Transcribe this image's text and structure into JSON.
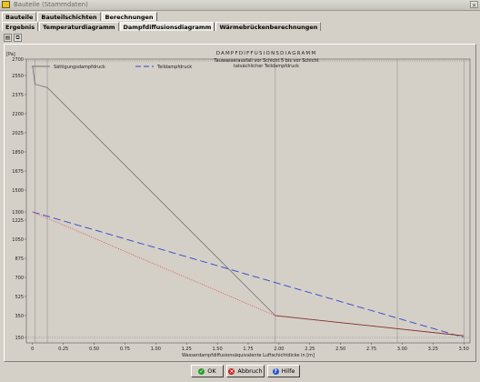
{
  "window": {
    "title": "Bauteile (Stammdaten)",
    "close_glyph": "×"
  },
  "tabs_top": [
    {
      "label": "Bauteile",
      "active": false
    },
    {
      "label": "Bauteilschichten",
      "active": false
    },
    {
      "label": "Berechnungen",
      "active": true
    }
  ],
  "tabs_sub": [
    {
      "label": "Ergebnis",
      "active": false
    },
    {
      "label": "Temperaturdiagramm",
      "active": false
    },
    {
      "label": "Dampfdiffusionsdiagramm",
      "active": true
    },
    {
      "label": "Wärmebrückenberechnungen",
      "active": false
    }
  ],
  "toolbar": {
    "print_icon": "printer-icon",
    "copy_icon": "copy-icon"
  },
  "chart_data": {
    "type": "line",
    "title": "DAMPFDIFFUSIONSDIAGRAMM",
    "subtitle_lines": [
      "Tauwasserausfall vor Schicht 5 bis vor Schicht",
      "tatsächlicher Teildampfdruck"
    ],
    "y_unit": "[Pa]",
    "xlabel": "Wasserdampfdiffusionsäquivalente Luftschichtdicke in [m]",
    "xlim": [
      -0.05,
      3.55
    ],
    "ylim": [
      100,
      2700
    ],
    "y_ticks": [
      150,
      350,
      525,
      700,
      875,
      1050,
      1225,
      1300,
      1500,
      1675,
      1850,
      2025,
      2200,
      2375,
      2550,
      2700
    ],
    "y_tick_labels": [
      "150",
      "350",
      "525",
      "700",
      "875",
      "1050",
      "1225",
      "1300",
      "1500",
      "1675",
      "1850",
      "2025",
      "2200",
      "2375",
      "2550",
      "2700"
    ],
    "x_ticks": [
      0,
      0.25,
      0.5,
      0.75,
      1.0,
      1.25,
      1.5,
      1.75,
      2.0,
      2.25,
      2.5,
      2.75,
      3.0,
      3.25,
      3.5
    ],
    "x_tick_labels": [
      "0",
      "0.25",
      "0.50",
      "0.75",
      "1.00",
      "1.25",
      "1.50",
      "1.75",
      "2.00",
      "2.25",
      "2.50",
      "2.75",
      "3.00",
      "3.25",
      "3.50"
    ],
    "layer_boundaries": [
      0.02,
      0.12,
      1.97,
      2.96,
      3.5
    ],
    "series": [
      {
        "name": "Sättigungsdampfdruck",
        "color": "#707070",
        "dash": "solid",
        "x": [
          0,
          0.02,
          0.12,
          1.97,
          2.96,
          3.5
        ],
        "y": [
          2640,
          2470,
          2440,
          350,
          230,
          165
        ]
      },
      {
        "name": "Teildampfdruck",
        "color": "#3344cc",
        "dash": "dashed",
        "x": [
          0,
          3.5
        ],
        "y": [
          1300,
          150
        ]
      },
      {
        "name": "tatsächlicher Teildampfdruck",
        "color": "#e04040",
        "dash": "dotted",
        "x": [
          0,
          1.97,
          2.96,
          3.5
        ],
        "y": [
          1300,
          350,
          230,
          165
        ]
      },
      {
        "name": "",
        "color": "#8a3030",
        "dash": "solid",
        "x": [
          1.97,
          2.96,
          3.5
        ],
        "y": [
          350,
          230,
          165
        ]
      }
    ]
  },
  "buttons": {
    "ok": "OK",
    "cancel": "Abbruch",
    "help": "Hilfe"
  },
  "colors": {
    "ok_icon": "#2a9d2a",
    "cancel_icon": "#cc2222",
    "help_icon": "#2255cc"
  }
}
